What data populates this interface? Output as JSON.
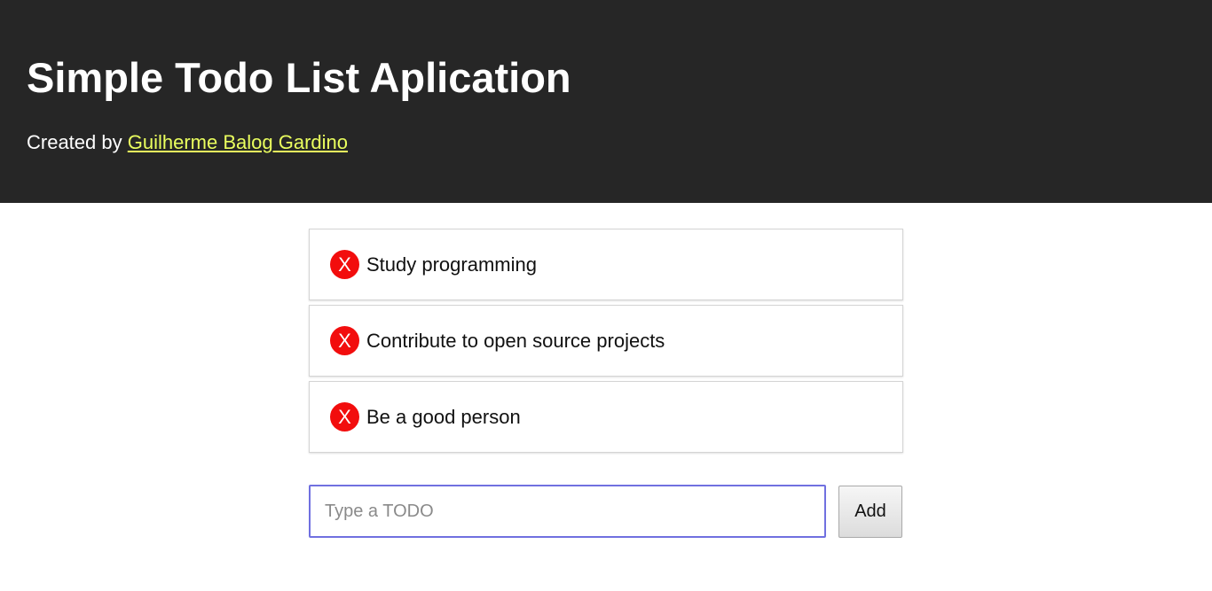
{
  "header": {
    "title": "Simple Todo List Aplication",
    "byline_prefix": "Created by",
    "author_link": "Guilherme Balog Gardino"
  },
  "todos": [
    {
      "remove_label": "X",
      "text": "Study programming"
    },
    {
      "remove_label": "X",
      "text": "Contribute to open source projects"
    },
    {
      "remove_label": "X",
      "text": "Be a good person"
    }
  ],
  "form": {
    "input_value": "",
    "input_placeholder": "Type a TODO",
    "add_label": "Add"
  },
  "colors": {
    "header_bg": "#262626",
    "link": "#eaff5e",
    "remove_button": "#f20d0d",
    "input_focus_border": "#7070e0"
  }
}
